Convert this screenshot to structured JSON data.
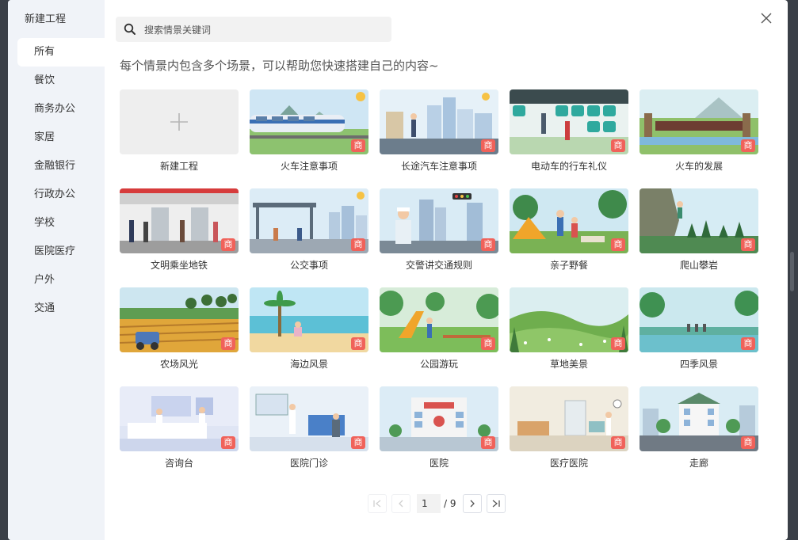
{
  "sidebar": {
    "title": "新建工程",
    "categories": [
      {
        "label": "所有",
        "active": true
      },
      {
        "label": "餐饮"
      },
      {
        "label": "商务办公"
      },
      {
        "label": "家居"
      },
      {
        "label": "金融银行"
      },
      {
        "label": "行政办公"
      },
      {
        "label": "学校"
      },
      {
        "label": "医院医疗"
      },
      {
        "label": "户外"
      },
      {
        "label": "交通"
      }
    ]
  },
  "search": {
    "placeholder": "搜索情景关键词",
    "icon": "search-icon"
  },
  "subtitle": "每个情景内包含多个场景，可以帮助您快速搭建自己的内容~",
  "new_project": {
    "label": "新建工程",
    "icon": "plus-icon"
  },
  "badge": "商",
  "templates": [
    {
      "label": "火车注意事项"
    },
    {
      "label": "长途汽车注意事项"
    },
    {
      "label": "电动车的行车礼仪"
    },
    {
      "label": "火车的发展"
    },
    {
      "label": "文明乘坐地铁"
    },
    {
      "label": "公交事项"
    },
    {
      "label": "交警讲交通规则"
    },
    {
      "label": "亲子野餐"
    },
    {
      "label": "爬山攀岩"
    },
    {
      "label": "农场风光"
    },
    {
      "label": "海边风景"
    },
    {
      "label": "公园游玩"
    },
    {
      "label": "草地美景"
    },
    {
      "label": "四季风景"
    },
    {
      "label": "咨询台"
    },
    {
      "label": "医院门诊"
    },
    {
      "label": "医院"
    },
    {
      "label": "医疗医院"
    },
    {
      "label": "走廊"
    }
  ],
  "pagination": {
    "current": "1",
    "total": "/ 9"
  },
  "colors": {
    "badge": "#f0625a",
    "sidebar_bg": "#f0f3f8"
  }
}
